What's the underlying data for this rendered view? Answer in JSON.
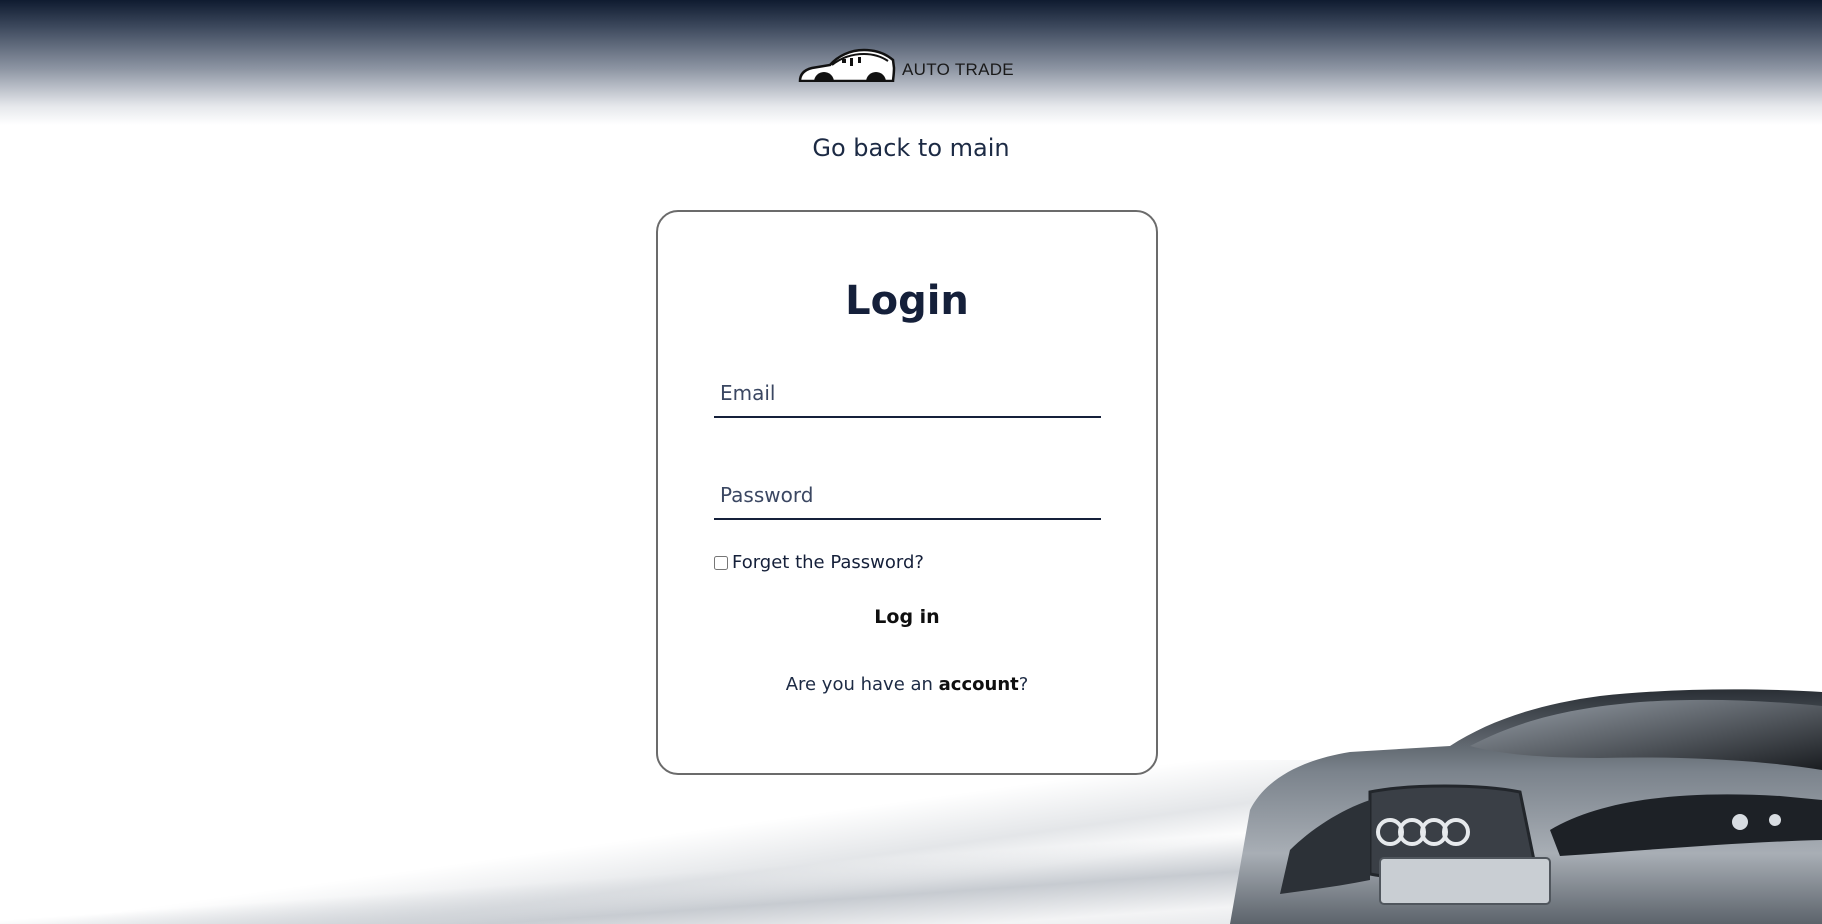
{
  "header": {
    "brand_name": "AUTO TRADE",
    "logo_icon": "car-silhouette-icon",
    "gradient_top_color": "#0f1b30"
  },
  "nav": {
    "back_link": "Go back to main"
  },
  "login_form": {
    "title": "Login",
    "email": {
      "placeholder": "Email",
      "value": ""
    },
    "password": {
      "placeholder": "Password",
      "value": ""
    },
    "remember_checkbox": {
      "label": "Forget the Password?",
      "checked": false
    },
    "submit_label": "Log in",
    "signup_prompt": {
      "prefix": "Are you have an ",
      "link": "account",
      "suffix": "?"
    }
  },
  "colors": {
    "accent_navy": "#15203a",
    "card_border": "#6b6b6b"
  },
  "decoration": {
    "hero_image": "silver-audi-car-front"
  }
}
